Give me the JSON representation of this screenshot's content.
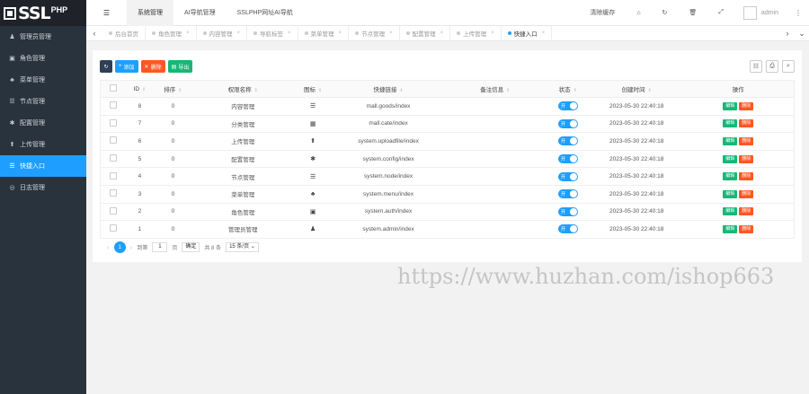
{
  "logo": {
    "ssl": "SSL",
    "php": "PHP"
  },
  "sidebar": {
    "items": [
      {
        "label": "管理员管理",
        "icon": "user-icon",
        "glyph": "♟"
      },
      {
        "label": "角色管理",
        "icon": "id-card-icon",
        "glyph": "▣"
      },
      {
        "label": "菜单管理",
        "icon": "tree-icon",
        "glyph": "♣"
      },
      {
        "label": "节点管理",
        "icon": "list-icon",
        "glyph": "☰"
      },
      {
        "label": "配置管理",
        "icon": "gear-icon",
        "glyph": "✱"
      },
      {
        "label": "上传管理",
        "icon": "upload-icon",
        "glyph": "⬆"
      },
      {
        "label": "快捷入口",
        "icon": "list-icon",
        "glyph": "☰",
        "active": true
      },
      {
        "label": "日志管理",
        "icon": "log-icon",
        "glyph": "◎"
      }
    ]
  },
  "header": {
    "menu_glyph": "☰",
    "tabs": [
      "系统管理",
      "AI导航管理",
      "SSLPHP网址AI导航"
    ],
    "active_tab": 0,
    "right": {
      "clear_cache": "清除缓存",
      "more_glyph": "⋮",
      "username": "admin"
    }
  },
  "tabbar": {
    "tabs": [
      {
        "label": "后台首页"
      },
      {
        "label": "角色管理"
      },
      {
        "label": "内容管理"
      },
      {
        "label": "导航标签"
      },
      {
        "label": "菜单管理"
      },
      {
        "label": "节点管理"
      },
      {
        "label": "配置管理"
      },
      {
        "label": "上传管理"
      },
      {
        "label": "快捷入口",
        "active": true
      }
    ],
    "close_glyph": "×"
  },
  "toolbar": {
    "add_label": "添加",
    "delete_label": "删除",
    "export_label": "导出"
  },
  "table": {
    "columns": [
      "ID",
      "排序",
      "权限名称",
      "图标",
      "快捷链接",
      "备注信息",
      "状态",
      "创建时间",
      "操作"
    ],
    "rows": [
      {
        "id": "8",
        "sort": "0",
        "name": "内容管理",
        "icon": "list-icon",
        "glyph": "☰",
        "url": "mall.goods/index",
        "remark": "",
        "status": "开",
        "created": "2023-05-30 22:40:18"
      },
      {
        "id": "7",
        "sort": "0",
        "name": "分类管理",
        "icon": "calendar-icon",
        "glyph": "▦",
        "url": "mall.cate/index",
        "remark": "",
        "status": "开",
        "created": "2023-05-30 22:40:18"
      },
      {
        "id": "6",
        "sort": "0",
        "name": "上传管理",
        "icon": "upload-icon",
        "glyph": "⬆",
        "url": "system.uploadfile/index",
        "remark": "",
        "status": "开",
        "created": "2023-05-30 22:40:18"
      },
      {
        "id": "5",
        "sort": "0",
        "name": "配置管理",
        "icon": "gear-icon",
        "glyph": "✱",
        "url": "system.config/index",
        "remark": "",
        "status": "开",
        "created": "2023-05-30 22:40:18"
      },
      {
        "id": "4",
        "sort": "0",
        "name": "节点管理",
        "icon": "list-icon",
        "glyph": "☰",
        "url": "system.node/index",
        "remark": "",
        "status": "开",
        "created": "2023-05-30 22:40:18"
      },
      {
        "id": "3",
        "sort": "0",
        "name": "菜单管理",
        "icon": "tree-icon",
        "glyph": "♣",
        "url": "system.menu/index",
        "remark": "",
        "status": "开",
        "created": "2023-05-30 22:40:18"
      },
      {
        "id": "2",
        "sort": "0",
        "name": "角色管理",
        "icon": "id-card-icon",
        "glyph": "▣",
        "url": "system.auth/index",
        "remark": "",
        "status": "开",
        "created": "2023-05-30 22:40:18"
      },
      {
        "id": "1",
        "sort": "0",
        "name": "管理员管理",
        "icon": "user-icon",
        "glyph": "♟",
        "url": "system.admin/index",
        "remark": "",
        "status": "开",
        "created": "2023-05-30 22:40:18"
      }
    ],
    "edit_label": "编辑",
    "delete_label": "删除"
  },
  "pager": {
    "current": "1",
    "goto_label": "到第",
    "page_value": "1",
    "page_unit": "页",
    "confirm_label": "确定",
    "total_label": "共 8 条",
    "per_page": "15 条/页"
  },
  "watermark": "https://www.huzhan.com/ishop663",
  "colors": {
    "accent": "#1e9fff",
    "sidebar": "#28333e",
    "success": "#16b777",
    "danger": "#ff5722",
    "dark": "#2f4056"
  }
}
